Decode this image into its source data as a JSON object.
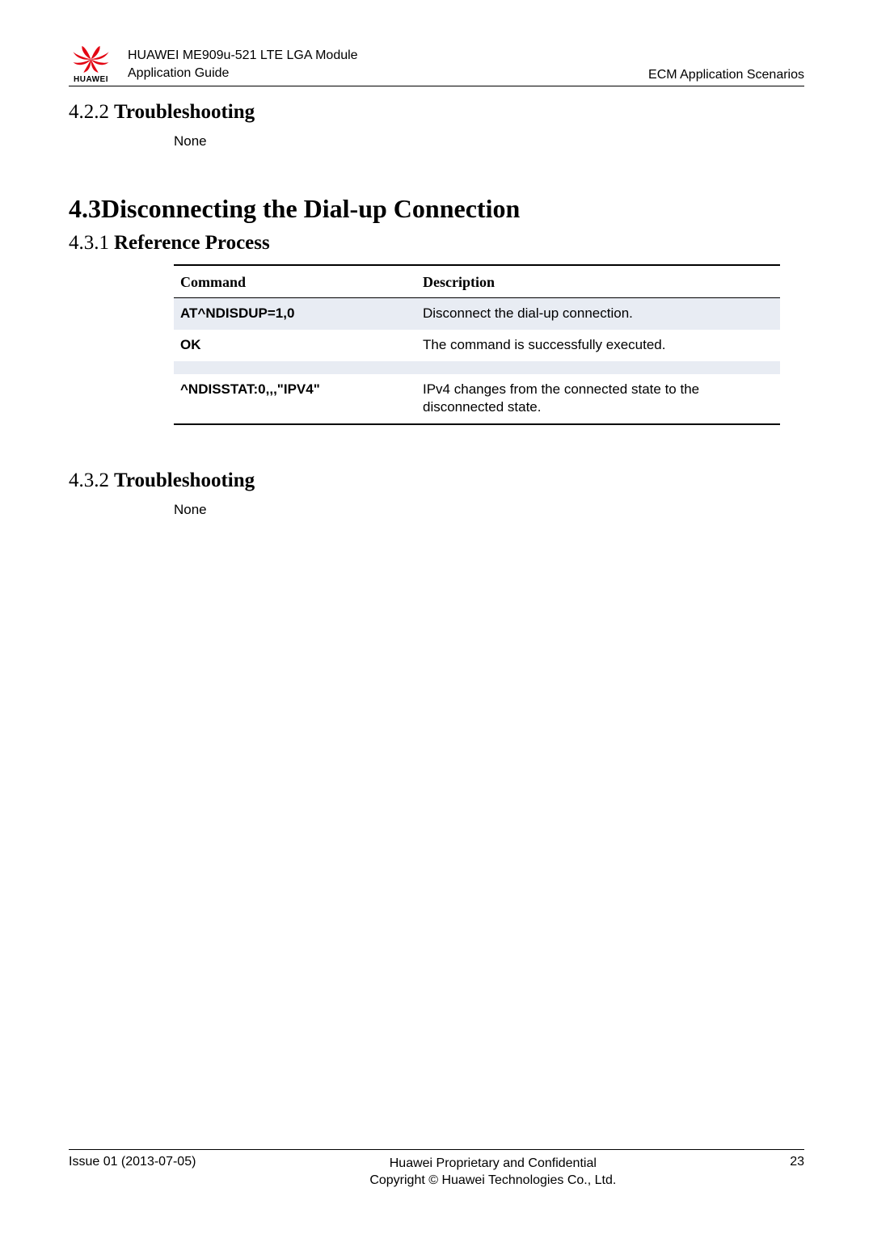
{
  "header": {
    "logo_text": "HUAWEI",
    "title_line1": "HUAWEI ME909u-521 LTE LGA Module",
    "title_line2": "Application Guide",
    "right": "ECM  Application  Scenarios"
  },
  "sections": {
    "s422": {
      "num": "4.2.2",
      "title": "Troubleshooting",
      "body": "None"
    },
    "s43": {
      "num": "4.3",
      "title": "Disconnecting the Dial-up Connection"
    },
    "s431": {
      "num": "4.3.1",
      "title": "Reference Process"
    },
    "s432": {
      "num": "4.3.2",
      "title": "Troubleshooting",
      "body": "None"
    }
  },
  "table": {
    "head": {
      "c1": "Command",
      "c2": "Description"
    },
    "rows": [
      {
        "cmd": "AT^NDISDUP=1,0",
        "desc": "Disconnect the dial-up connection.",
        "shaded": true
      },
      {
        "cmd": "OK",
        "desc": "The command is successfully executed.",
        "shaded": false
      },
      {
        "cmd": "",
        "desc": "",
        "shaded": true
      },
      {
        "cmd": "^NDISSTAT:0,,,\"IPV4\"",
        "desc": "IPv4 changes from the connected state to the disconnected state.",
        "shaded": false
      }
    ]
  },
  "footer": {
    "left": "Issue 01 (2013-07-05)",
    "center_line1": "Huawei Proprietary and Confidential",
    "center_line2": "Copyright © Huawei Technologies Co., Ltd.",
    "right": "23"
  }
}
